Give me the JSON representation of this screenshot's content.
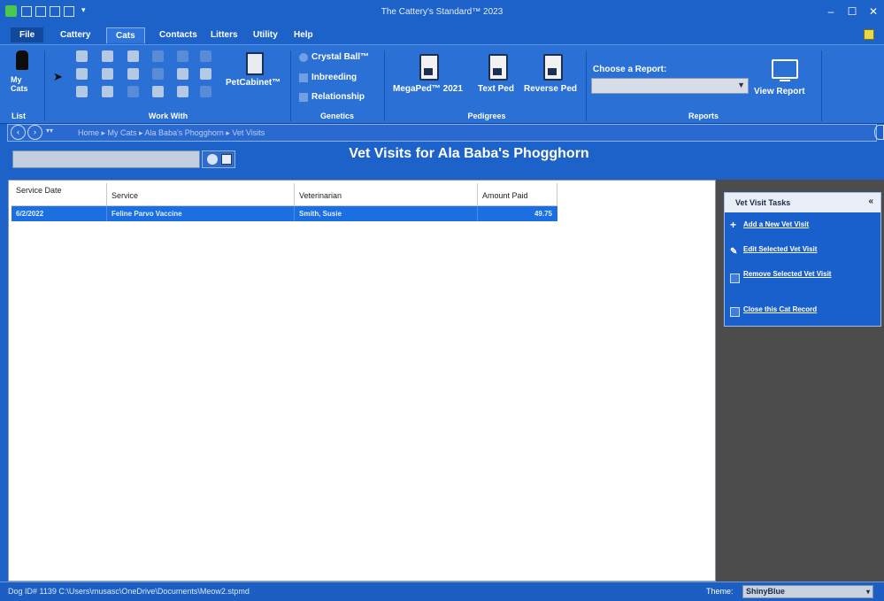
{
  "window": {
    "title": "The Cattery's Standard™ 2023",
    "minimize": "–",
    "maximize": "☐",
    "close": "✕"
  },
  "menu": {
    "items": [
      "File",
      "Cattery",
      "Cats",
      "Contacts",
      "Litters",
      "Utility",
      "Help"
    ],
    "active": "Cats"
  },
  "ribbon": {
    "list": {
      "my_cats_label": "My Cats",
      "group_label": "List"
    },
    "work_with": {
      "group_label": "Work With"
    },
    "pet_cabinet": {
      "label": "PetCabinet™"
    },
    "genetics": {
      "items": [
        "Crystal Ball™",
        "Inbreeding",
        "Relationship"
      ],
      "group_label": "Genetics"
    },
    "pedigrees": {
      "items": [
        "MegaPed™ 2021",
        "Text Ped",
        "Reverse Ped"
      ],
      "group_label": "Pedigrees"
    },
    "reports": {
      "choose_label": "Choose a Report:",
      "selected": "",
      "view_label": "View Report",
      "group_label": "Reports"
    }
  },
  "nav": {
    "back_icon": "back-arrow-icon",
    "forward_icon": "forward-arrow-icon",
    "breadcrumb": "Home ▸ My Cats ▸ Ala Baba's Phogghorn ▸ Vet Visits"
  },
  "header": {
    "search_value": "",
    "title": "Vet Visits for Ala Baba's Phogghorn"
  },
  "grid": {
    "columns": [
      "Service Date",
      "Service",
      "Veterinarian",
      "Amount Paid"
    ],
    "rows": [
      {
        "date": "6/2/2022",
        "service": "Feline Parvo Vaccine",
        "vet": "Smith, Susie",
        "amount": "49.75"
      }
    ]
  },
  "tasks": {
    "title": "Vet Visit Tasks",
    "items": [
      "Add a New Vet Visit",
      "Edit Selected Vet Visit",
      "Remove Selected Vet Visit",
      "Close this Cat Record"
    ]
  },
  "status": {
    "text": "Dog ID# 1139   C:\\Users\\musasc\\OneDrive\\Documents\\Meow2.stpmd",
    "theme_label": "Theme:",
    "theme_value": "ShinyBlue"
  },
  "colors": {
    "accent": "#1d62c8",
    "selection": "#1c6fe0",
    "pane": "#4c4c4c"
  }
}
